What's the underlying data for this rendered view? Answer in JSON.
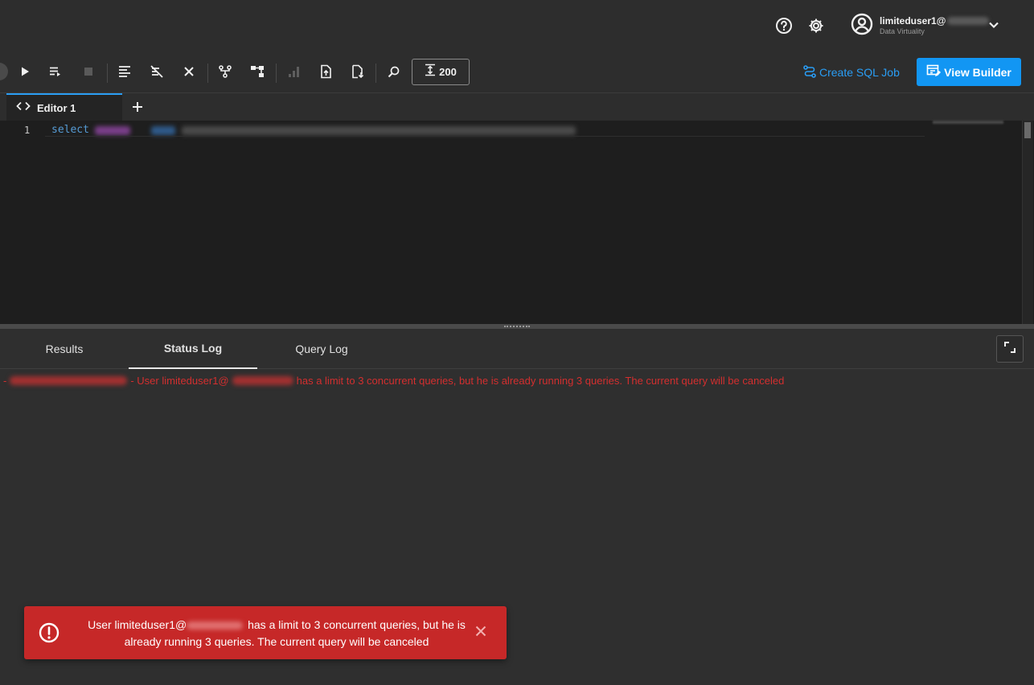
{
  "header": {
    "help_icon": "question-circle-icon",
    "settings_icon": "gear-icon",
    "user": {
      "name": "limiteduser1@",
      "org": "Data Virtuality",
      "avatar_icon": "user-circle-icon",
      "caret_icon": "chevron-down-icon"
    }
  },
  "toolbar": {
    "row_limit": "200",
    "create_job_label": "Create SQL Job",
    "view_builder_label": "View Builder",
    "accent_color": "#1296f3"
  },
  "editor": {
    "tabs": [
      {
        "label": "Editor 1"
      }
    ],
    "lines": [
      {
        "number": "1",
        "keyword": "select"
      }
    ]
  },
  "bottom_tabs": [
    {
      "label": "Results",
      "active": false
    },
    {
      "label": "Status Log",
      "active": true
    },
    {
      "label": "Query Log",
      "active": false
    }
  ],
  "status_log": {
    "entry_prefix": "-",
    "entry_part1": "- User limiteduser1@",
    "entry_part2": "has a limit to 3 concurrent queries, but he is already running 3 queries. The current query will be canceled",
    "error_color": "#d32f2f"
  },
  "toast": {
    "part1": "User limiteduser1@",
    "part2": "has a limit to 3 concurrent queries, but he is",
    "line2": "already running 3 queries. The current query will be canceled",
    "background": "#c62828"
  }
}
